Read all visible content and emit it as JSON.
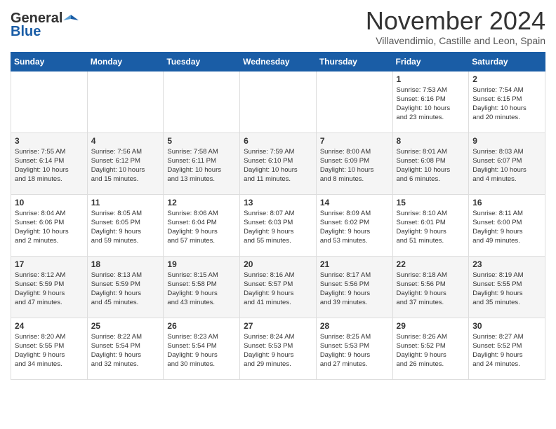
{
  "header": {
    "logo_general": "General",
    "logo_blue": "Blue",
    "month_title": "November 2024",
    "location": "Villavendimio, Castille and Leon, Spain"
  },
  "weekdays": [
    "Sunday",
    "Monday",
    "Tuesday",
    "Wednesday",
    "Thursday",
    "Friday",
    "Saturday"
  ],
  "rows": [
    [
      {
        "day": "",
        "info": ""
      },
      {
        "day": "",
        "info": ""
      },
      {
        "day": "",
        "info": ""
      },
      {
        "day": "",
        "info": ""
      },
      {
        "day": "",
        "info": ""
      },
      {
        "day": "1",
        "info": "Sunrise: 7:53 AM\nSunset: 6:16 PM\nDaylight: 10 hours\nand 23 minutes."
      },
      {
        "day": "2",
        "info": "Sunrise: 7:54 AM\nSunset: 6:15 PM\nDaylight: 10 hours\nand 20 minutes."
      }
    ],
    [
      {
        "day": "3",
        "info": "Sunrise: 7:55 AM\nSunset: 6:14 PM\nDaylight: 10 hours\nand 18 minutes."
      },
      {
        "day": "4",
        "info": "Sunrise: 7:56 AM\nSunset: 6:12 PM\nDaylight: 10 hours\nand 15 minutes."
      },
      {
        "day": "5",
        "info": "Sunrise: 7:58 AM\nSunset: 6:11 PM\nDaylight: 10 hours\nand 13 minutes."
      },
      {
        "day": "6",
        "info": "Sunrise: 7:59 AM\nSunset: 6:10 PM\nDaylight: 10 hours\nand 11 minutes."
      },
      {
        "day": "7",
        "info": "Sunrise: 8:00 AM\nSunset: 6:09 PM\nDaylight: 10 hours\nand 8 minutes."
      },
      {
        "day": "8",
        "info": "Sunrise: 8:01 AM\nSunset: 6:08 PM\nDaylight: 10 hours\nand 6 minutes."
      },
      {
        "day": "9",
        "info": "Sunrise: 8:03 AM\nSunset: 6:07 PM\nDaylight: 10 hours\nand 4 minutes."
      }
    ],
    [
      {
        "day": "10",
        "info": "Sunrise: 8:04 AM\nSunset: 6:06 PM\nDaylight: 10 hours\nand 2 minutes."
      },
      {
        "day": "11",
        "info": "Sunrise: 8:05 AM\nSunset: 6:05 PM\nDaylight: 9 hours\nand 59 minutes."
      },
      {
        "day": "12",
        "info": "Sunrise: 8:06 AM\nSunset: 6:04 PM\nDaylight: 9 hours\nand 57 minutes."
      },
      {
        "day": "13",
        "info": "Sunrise: 8:07 AM\nSunset: 6:03 PM\nDaylight: 9 hours\nand 55 minutes."
      },
      {
        "day": "14",
        "info": "Sunrise: 8:09 AM\nSunset: 6:02 PM\nDaylight: 9 hours\nand 53 minutes."
      },
      {
        "day": "15",
        "info": "Sunrise: 8:10 AM\nSunset: 6:01 PM\nDaylight: 9 hours\nand 51 minutes."
      },
      {
        "day": "16",
        "info": "Sunrise: 8:11 AM\nSunset: 6:00 PM\nDaylight: 9 hours\nand 49 minutes."
      }
    ],
    [
      {
        "day": "17",
        "info": "Sunrise: 8:12 AM\nSunset: 5:59 PM\nDaylight: 9 hours\nand 47 minutes."
      },
      {
        "day": "18",
        "info": "Sunrise: 8:13 AM\nSunset: 5:59 PM\nDaylight: 9 hours\nand 45 minutes."
      },
      {
        "day": "19",
        "info": "Sunrise: 8:15 AM\nSunset: 5:58 PM\nDaylight: 9 hours\nand 43 minutes."
      },
      {
        "day": "20",
        "info": "Sunrise: 8:16 AM\nSunset: 5:57 PM\nDaylight: 9 hours\nand 41 minutes."
      },
      {
        "day": "21",
        "info": "Sunrise: 8:17 AM\nSunset: 5:56 PM\nDaylight: 9 hours\nand 39 minutes."
      },
      {
        "day": "22",
        "info": "Sunrise: 8:18 AM\nSunset: 5:56 PM\nDaylight: 9 hours\nand 37 minutes."
      },
      {
        "day": "23",
        "info": "Sunrise: 8:19 AM\nSunset: 5:55 PM\nDaylight: 9 hours\nand 35 minutes."
      }
    ],
    [
      {
        "day": "24",
        "info": "Sunrise: 8:20 AM\nSunset: 5:55 PM\nDaylight: 9 hours\nand 34 minutes."
      },
      {
        "day": "25",
        "info": "Sunrise: 8:22 AM\nSunset: 5:54 PM\nDaylight: 9 hours\nand 32 minutes."
      },
      {
        "day": "26",
        "info": "Sunrise: 8:23 AM\nSunset: 5:54 PM\nDaylight: 9 hours\nand 30 minutes."
      },
      {
        "day": "27",
        "info": "Sunrise: 8:24 AM\nSunset: 5:53 PM\nDaylight: 9 hours\nand 29 minutes."
      },
      {
        "day": "28",
        "info": "Sunrise: 8:25 AM\nSunset: 5:53 PM\nDaylight: 9 hours\nand 27 minutes."
      },
      {
        "day": "29",
        "info": "Sunrise: 8:26 AM\nSunset: 5:52 PM\nDaylight: 9 hours\nand 26 minutes."
      },
      {
        "day": "30",
        "info": "Sunrise: 8:27 AM\nSunset: 5:52 PM\nDaylight: 9 hours\nand 24 minutes."
      }
    ]
  ]
}
